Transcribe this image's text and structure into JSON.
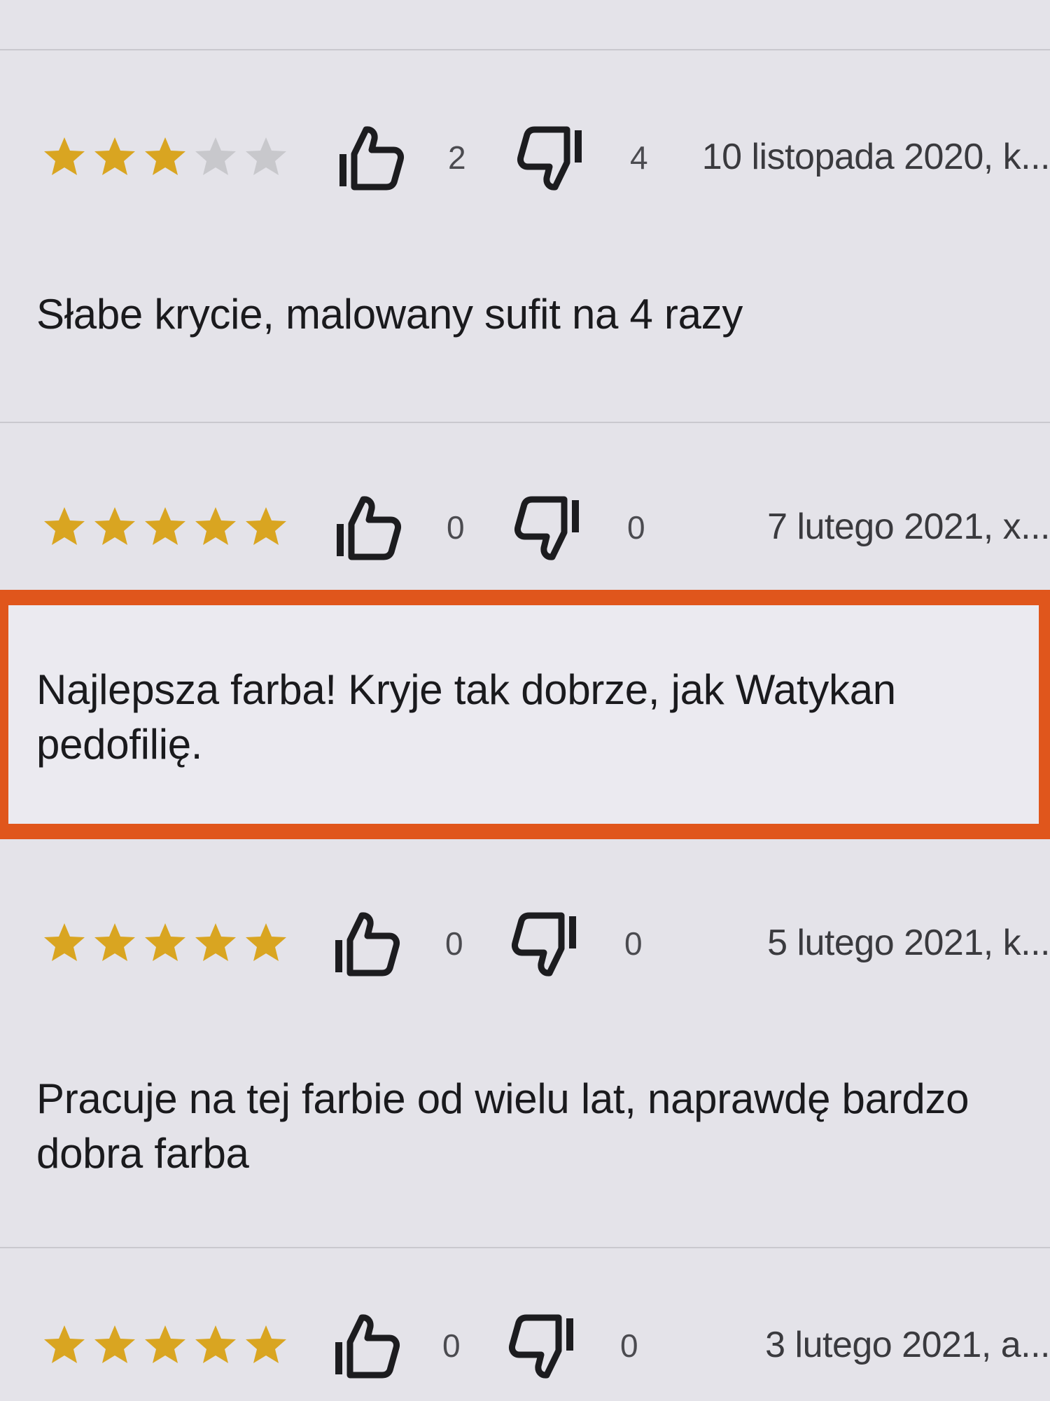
{
  "colors": {
    "star_filled": "#d9a521",
    "star_empty": "#c8c8cc",
    "highlight_border": "#e0561c",
    "icon": "#1c1c1f"
  },
  "icons": {
    "like": "thumbs-up-icon",
    "dislike": "thumbs-down-icon",
    "rating": "star-icon"
  },
  "reviews": [
    {
      "rating": 3,
      "likes": "2",
      "dislikes": "4",
      "date": "10 listopada 2020, k...",
      "text": "Słabe krycie, malowany sufit na 4 razy",
      "highlighted": false
    },
    {
      "rating": 5,
      "likes": "0",
      "dislikes": "0",
      "date": "7 lutego 2021, x...",
      "text": "Najlepsza farba! Kryje tak dobrze, jak Watykan pedofilię.",
      "highlighted": true
    },
    {
      "rating": 5,
      "likes": "0",
      "dislikes": "0",
      "date": "5 lutego 2021, k...",
      "text": "Pracuje na tej farbie od wielu lat, naprawdę bardzo dobra farba",
      "highlighted": false
    },
    {
      "rating": 5,
      "likes": "0",
      "dislikes": "0",
      "date": "3 lutego 2021, a...",
      "text": "",
      "highlighted": false
    }
  ]
}
